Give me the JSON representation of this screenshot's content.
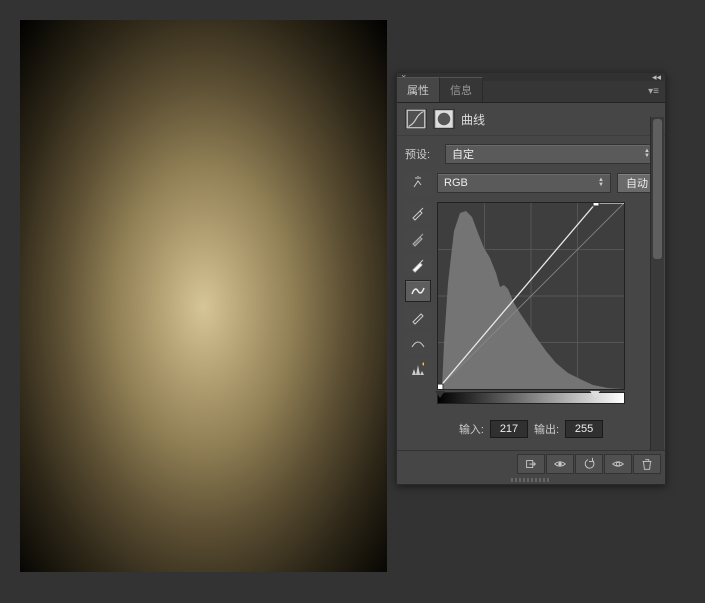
{
  "tabs": {
    "properties": "属性",
    "info": "信息"
  },
  "header": {
    "curves_label": "曲线"
  },
  "preset": {
    "label": "预设:",
    "value": "自定"
  },
  "channel": {
    "value": "RGB",
    "auto_label": "自动"
  },
  "io": {
    "input_label": "输入:",
    "input_value": "217",
    "output_label": "输出:",
    "output_value": "255"
  },
  "colors": {
    "panel_bg": "#464646",
    "canvas_bg": "#333333"
  },
  "chart_data": {
    "type": "line",
    "title": "",
    "xlabel": "输入",
    "ylabel": "输出",
    "xlim": [
      0,
      255
    ],
    "ylim": [
      0,
      255
    ],
    "points": [
      {
        "x": 0,
        "y": 0
      },
      {
        "x": 217,
        "y": 255
      }
    ],
    "histogram_hint": "single-mode dark-weighted histogram peaking near low-mid tones"
  }
}
